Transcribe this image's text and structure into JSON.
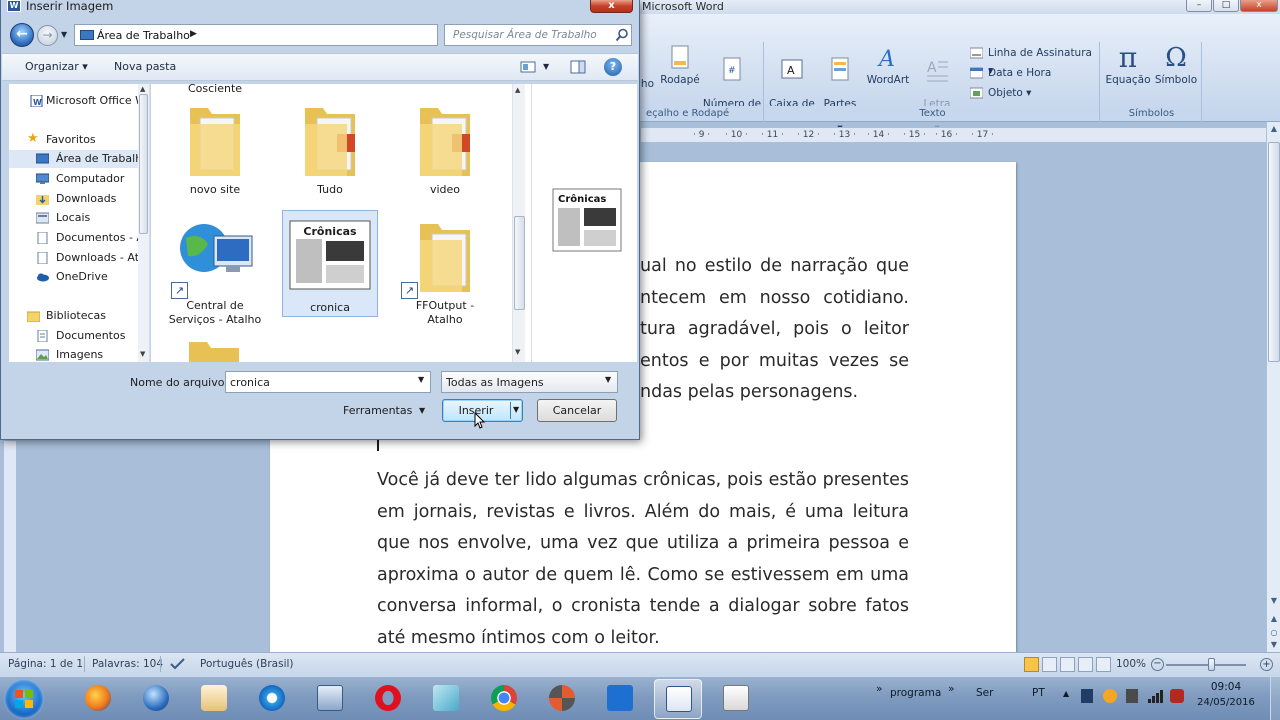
{
  "word": {
    "title": "Microsoft Word",
    "ribbon": {
      "header_footer_group": {
        "label": "eçalho e Rodapé",
        "buttons": [
          "lho",
          "Rodapé",
          "Número de\nPágina ▾"
        ]
      },
      "text_group": {
        "label": "Texto",
        "buttons": [
          "Caixa de\nTexto ▾",
          "Partes\nRápidas ▾",
          "WordArt",
          "Letra\nCapitular ▾"
        ],
        "small": [
          "Linha de Assinatura ▾",
          "Data e Hora",
          "Objeto ▾"
        ]
      },
      "symbols_group": {
        "label": "Símbolos",
        "buttons": [
          "Equação",
          "Símbolo"
        ],
        "glyphs": [
          "π",
          "Ω"
        ]
      }
    },
    "ruler_ticks": [
      "· 9 ·",
      "· 10 ·",
      "· 11 ·",
      "· 12 ·",
      "· 13 ·",
      "· 14 ·",
      "· 15 ·",
      "· 16 ·",
      "· 17 ·"
    ],
    "document": {
      "para1": "ual no estilo de narração que ntecem em nosso cotidiano. tura agradável, pois o leitor entos e por muitas vezes se ndas pelas personagens.",
      "para2": "Você já deve ter lido algumas crônicas, pois estão presentes em jornais, revistas e livros. Além do mais, é uma leitura que nos envolve, uma vez que utiliza a primeira pessoa e aproxima o autor de quem lê. Como se estivessem em uma conversa informal, o cronista tende a dialogar sobre fatos até mesmo íntimos com o leitor."
    },
    "status": {
      "page": "Página: 1 de 1",
      "words": "Palavras: 104",
      "language": "Português (Brasil)",
      "zoom": "100%",
      "zoom_level": 1.0
    }
  },
  "dialog": {
    "title": "Inserir Imagem",
    "address": "Área de Trabalho",
    "search_placeholder": "Pesquisar Área de Trabalho",
    "toolbar": {
      "organize": "Organizar ▾",
      "new_folder": "Nova pasta"
    },
    "nav": [
      {
        "label": "Microsoft Office W",
        "icon": "word-doc-icon"
      },
      {
        "label": "Favoritos",
        "icon": "star-icon"
      },
      {
        "label": "Área de Trabalh",
        "icon": "desktop-icon",
        "selected": true
      },
      {
        "label": "Computador",
        "icon": "computer-icon"
      },
      {
        "label": "Downloads",
        "icon": "downloads-folder-icon"
      },
      {
        "label": "Locais",
        "icon": "places-icon"
      },
      {
        "label": "Documentos - A",
        "icon": "document-shortcut-icon"
      },
      {
        "label": "Downloads - At",
        "icon": "document-shortcut-icon"
      },
      {
        "label": "OneDrive",
        "icon": "onedrive-icon"
      },
      {
        "label": "Bibliotecas",
        "icon": "libraries-icon"
      },
      {
        "label": "Documentos",
        "icon": "documents-icon"
      },
      {
        "label": "Imagens",
        "icon": "images-icon"
      }
    ],
    "files": [
      {
        "label": "Cosciente",
        "type": "folder-partial"
      },
      {
        "label": "novo site",
        "type": "folder"
      },
      {
        "label": "Tudo",
        "type": "folder-ppt"
      },
      {
        "label": "video",
        "type": "folder-ppt"
      },
      {
        "label": "Central de\nServiços - Atalho",
        "type": "network-shortcut"
      },
      {
        "label": "cronica",
        "type": "image",
        "selected": true
      },
      {
        "label": "FFOutput -\nAtalho",
        "type": "folder-shortcut"
      }
    ],
    "thumb_caption": "Crônicas",
    "filename_label": "Nome do arquivo:",
    "filename_value": "cronica",
    "filetype_value": "Todas as Imagens",
    "tools_label": "Ferramentas",
    "insert_label": "Inserir",
    "cancel_label": "Cancelar"
  },
  "taskbar": {
    "programs": [
      "start",
      "firefox",
      "google-earth",
      "hand-app",
      "internet-explorer",
      "app-window",
      "opera",
      "file-manager",
      "chrome",
      "app-s",
      "remote-app",
      "word",
      "java"
    ],
    "toolbar_labels": [
      "programa",
      "Ser"
    ],
    "chevrons": [
      "»",
      "»"
    ],
    "language": "PT",
    "time": "09:04",
    "date": "24/05/2016"
  },
  "colors": {
    "ribbon_text": "#1f3a5f",
    "taskbar": "#7f9bbf",
    "dialog_frame": "#c4d4e8",
    "selection": "#d9e7f8",
    "close": "#c7402a"
  }
}
